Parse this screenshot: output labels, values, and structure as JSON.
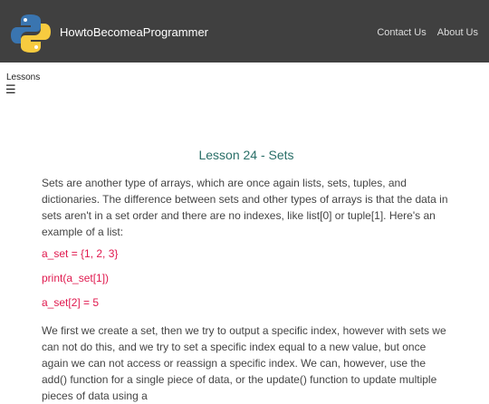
{
  "navbar": {
    "brand": "HowtoBecomeaProgrammer",
    "links": [
      {
        "label": "Contact Us"
      },
      {
        "label": "About Us"
      }
    ],
    "logo_colors": {
      "blue": "#3a75b0",
      "yellow": "#f7cb3f"
    }
  },
  "sidebar": {
    "label": "Lessons",
    "menu_icon": "☰"
  },
  "lesson": {
    "title": "Lesson 24 - Sets",
    "paragraph1": "Sets are another type of arrays, which are once again lists, sets, tuples, and dictionaries. The difference between sets and other types of arrays is that the data in sets aren't in a set order and there are no indexes, like list[0] or tuple[1]. Here's an example of a list:",
    "code": [
      "a_set = {1, 2, 3}",
      "print(a_set[1])",
      "a_set[2] = 5"
    ],
    "paragraph2": "We first we create a set, then we try to output a specific index, however with sets we can not do this, and we try to set a specific index equal to a new value, but once again we can not access or reassign a specific index. We can, however, use the add() function for a single piece of data, or the update() function to update multiple pieces of data using a"
  },
  "colors": {
    "navbar_bg": "#404040",
    "title": "#2a6f68",
    "code": "#e0194e"
  }
}
